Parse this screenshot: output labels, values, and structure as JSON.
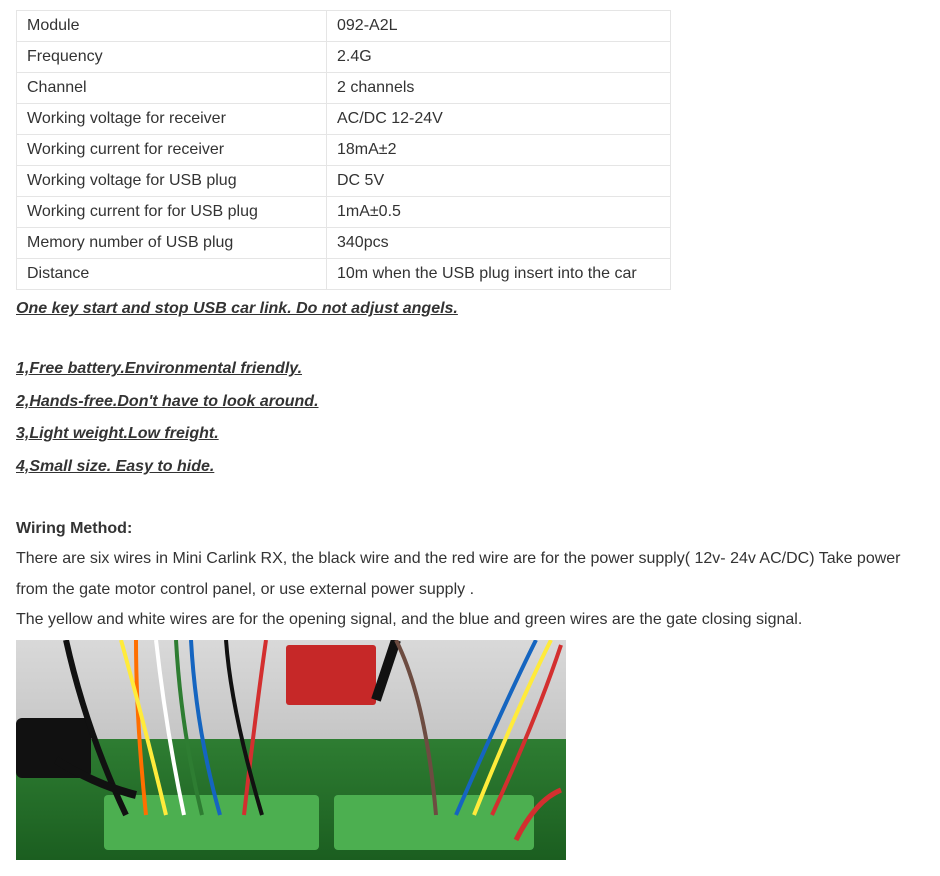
{
  "spec_table": {
    "rows": [
      {
        "label": "Module",
        "value": "092-A2L"
      },
      {
        "label": "Frequency",
        "value": "2.4G"
      },
      {
        "label": "Channel",
        "value": "2 channels"
      },
      {
        "label": "Working voltage for receiver",
        "value": "AC/DC 12-24V"
      },
      {
        "label": "Working current for receiver",
        "value": "18mA±2"
      },
      {
        "label": "Working voltage for USB plug",
        "value": "DC 5V"
      },
      {
        "label": "Working current for for USB plug",
        "value": "1mA±0.5"
      },
      {
        "label": "Memory number of USB plug",
        "value": "340pcs"
      },
      {
        "label": "Distance",
        "value": "10m when the USB plug insert into the car"
      }
    ]
  },
  "tagline": "One key start and stop USB car link. Do not adjust angels.",
  "features": [
    "1,Free battery.Environmental friendly.",
    "2,Hands-free.Don't have to look around.",
    "3,Light weight.Low freight.",
    "4,Small size. Easy to hide."
  ],
  "wiring": {
    "title": "Wiring Method:",
    "lines": [
      "There are six wires in Mini Carlink RX, the black wire and the red wire are for the power supply( 12v- 24v AC/DC) Take power from the gate motor control panel, or use external power supply .",
      "The yellow and white wires are for the opening signal, and the blue and green wires are the gate closing signal."
    ]
  }
}
